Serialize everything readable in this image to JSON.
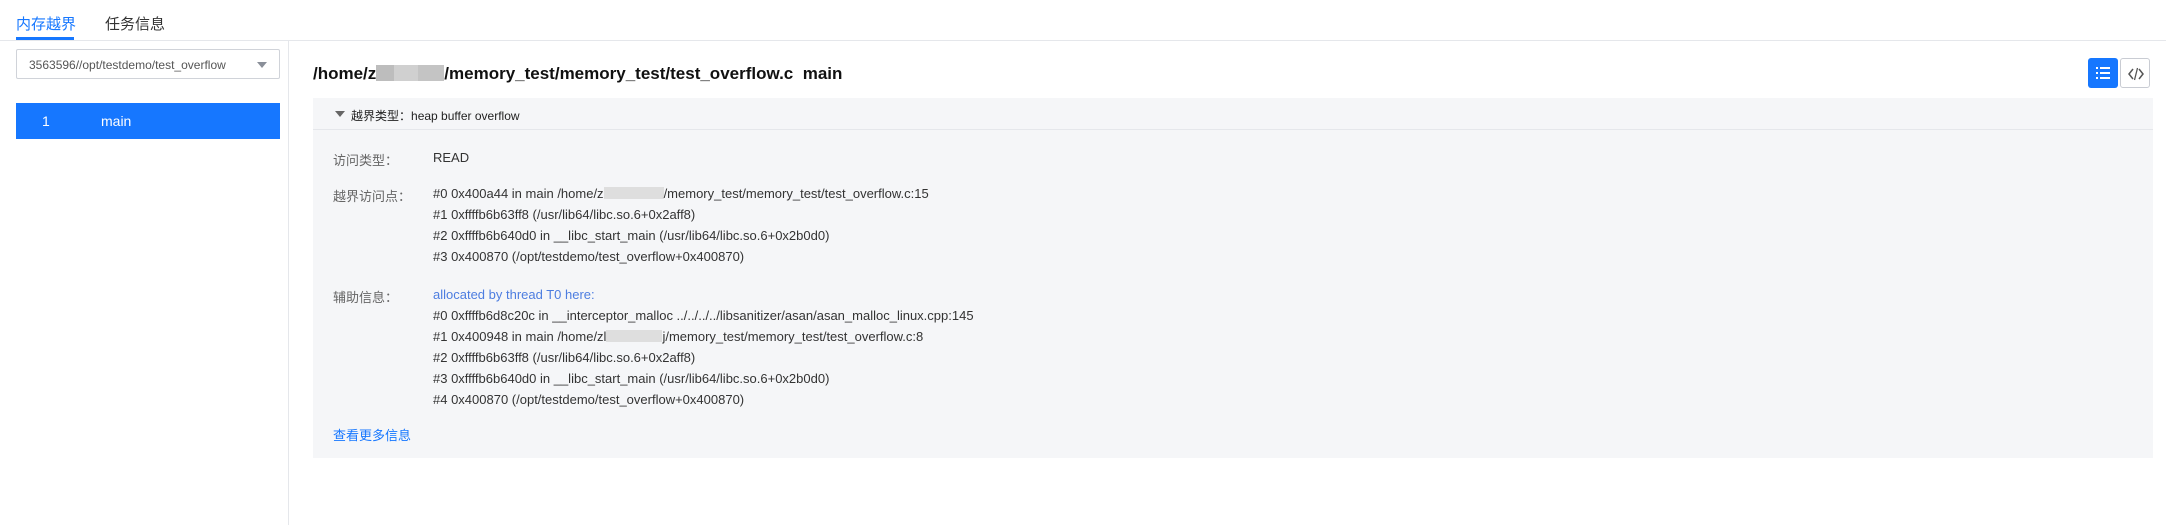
{
  "tabs": [
    {
      "label": "内存越界",
      "active": true
    },
    {
      "label": "任务信息",
      "active": false
    }
  ],
  "sidebar": {
    "select_value": "3563596//opt/testdemo/test_overflow",
    "functions": [
      {
        "index": "1",
        "name": "main"
      }
    ]
  },
  "header": {
    "path_prefix": "/home/z",
    "path_suffix": "/memory_test/memory_test/test_overflow.c",
    "function": "main"
  },
  "toolbar": {
    "list_icon": "list-icon",
    "code_icon": "code-icon"
  },
  "detail": {
    "overflow_type_label": "越界类型：",
    "overflow_type_value": "heap buffer overflow",
    "access_type_label": "访问类型：",
    "access_type_value": "READ",
    "access_point_label": "越界访问点：",
    "access_point_lines": {
      "l0_prefix": "#0 0x400a44 in main /home/z",
      "l0_suffix": "/memory_test/memory_test/test_overflow.c:15",
      "l1": "#1 0xffffb6b63ff8 (/usr/lib64/libc.so.6+0x2aff8)",
      "l2": "#2 0xffffb6b640d0 in __libc_start_main (/usr/lib64/libc.so.6+0x2b0d0)",
      "l3": "#3 0x400870 (/opt/testdemo/test_overflow+0x400870)"
    },
    "aux_label": "辅助信息：",
    "aux_lines": {
      "title": "allocated by thread T0 here:",
      "l0": "#0 0xffffb6d8c20c in __interceptor_malloc ../../../../libsanitizer/asan/asan_malloc_linux.cpp:145",
      "l1_prefix": "#1 0x400948 in main /home/zl",
      "l1_suffix": "j/memory_test/memory_test/test_overflow.c:8",
      "l2": "#2 0xffffb6b63ff8 (/usr/lib64/libc.so.6+0x2aff8)",
      "l3": "#3 0xffffb6b640d0 in __libc_start_main (/usr/lib64/libc.so.6+0x2b0d0)",
      "l4": "#4 0x400870 (/opt/testdemo/test_overflow+0x400870)"
    },
    "more_link": "查看更多信息"
  },
  "colors": {
    "accent": "#1677ff",
    "link_purple": "#4d7de0",
    "panel_bg": "#f5f6f8"
  }
}
